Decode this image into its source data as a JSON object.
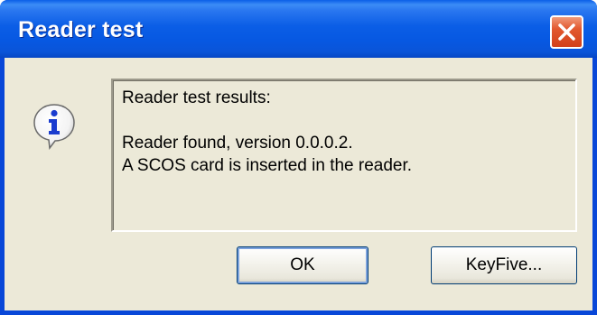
{
  "window": {
    "title": "Reader test"
  },
  "message": {
    "icon": "info-icon",
    "text": "Reader test results:\n\nReader found, version 0.0.0.2.\nA SCOS card is inserted in the reader."
  },
  "buttons": {
    "ok_label": "OK",
    "keyfive_label": "KeyFive..."
  },
  "colors": {
    "titlebar": "#0a5fe8",
    "dialog_face": "#ece9d8",
    "close_button": "#e2582e"
  }
}
